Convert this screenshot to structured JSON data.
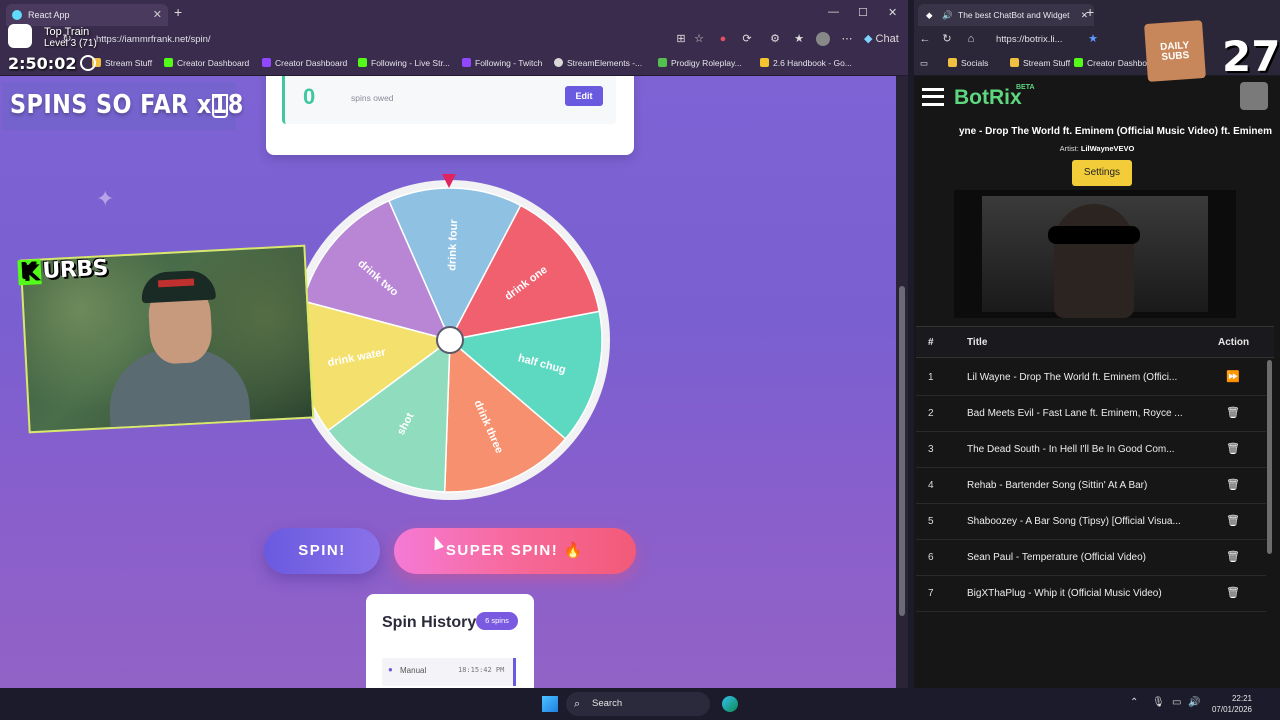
{
  "left_browser": {
    "tab_title": "React App",
    "url": "https://iammrfrank.net/spin/",
    "bookmarks": [
      "Stream Stuff",
      "Creator Dashboard",
      "Creator Dashboard",
      "Following - Live Str...",
      "Following - Twitch",
      "StreamElements -...",
      "Prodigy Roleplay...",
      "2.6 Handbook - Go..."
    ],
    "chat_label": "Chat"
  },
  "overlay": {
    "train_label": "Top Train",
    "train_level": "Level 3 (71)",
    "timer": "2:50:02",
    "spins_so_far": "SPINS SO FAR  x18"
  },
  "spin_card": {
    "count": "0",
    "label": "spins owed",
    "edit": "Edit"
  },
  "wheel": {
    "segments": [
      {
        "label": "drink four",
        "color": "#8fc1e3"
      },
      {
        "label": "drink one",
        "color": "#f0606e"
      },
      {
        "label": "half chug",
        "color": "#5dd9c1"
      },
      {
        "label": "drink three",
        "color": "#f6906e"
      },
      {
        "label": "shot",
        "color": "#8fdcbf"
      },
      {
        "label": "drink water",
        "color": "#f4e06d"
      },
      {
        "label": "drink two",
        "color": "#b886d4"
      }
    ]
  },
  "buttons": {
    "spin": "SPIN!",
    "super_spin": "SUPER SPIN! 🔥"
  },
  "history": {
    "title": "Spin History",
    "badge": "6 spins",
    "entry_type": "Manual",
    "entry_time": "18:15:42 PM"
  },
  "webcam": {
    "name": "URBS"
  },
  "right_browser": {
    "tab_title": "The best ChatBot and Widget",
    "url": "https://botrix.li...",
    "bookmarks": [
      "Socials",
      "Stream Stuff",
      "Creator Dashbo"
    ],
    "brand": "BotRix",
    "beta": "BETA",
    "now_playing": "yne - Drop The World ft. Eminem (Official Music Video) ft. Eminem",
    "artist_label": "Artist:",
    "artist": "LilWayneVEVO",
    "settings": "Settings",
    "table_headers": {
      "num": "#",
      "title": "Title",
      "action": "Action"
    },
    "queue": [
      {
        "n": "1",
        "title": "Lil Wayne - Drop The World ft. Eminem (Offici...",
        "action": "skip"
      },
      {
        "n": "2",
        "title": "Bad Meets Evil - Fast Lane ft. Eminem, Royce ...",
        "action": "delete"
      },
      {
        "n": "3",
        "title": "The Dead South - In Hell I'll Be In Good Com...",
        "action": "delete"
      },
      {
        "n": "4",
        "title": "Rehab - Bartender Song (Sittin' At A Bar)",
        "action": "delete"
      },
      {
        "n": "5",
        "title": "Shaboozey - A Bar Song (Tipsy) [Official Visua...",
        "action": "delete"
      },
      {
        "n": "6",
        "title": "Sean Paul - Temperature (Official Video)",
        "action": "delete"
      },
      {
        "n": "7",
        "title": "BigXThaPlug - Whip it (Official Music Video)",
        "action": "delete"
      }
    ]
  },
  "daily_subs": {
    "label": "DAILY SUBS",
    "count": "27"
  },
  "taskbar": {
    "search": "Search",
    "time": "22:21",
    "date": "07/01/2026"
  }
}
